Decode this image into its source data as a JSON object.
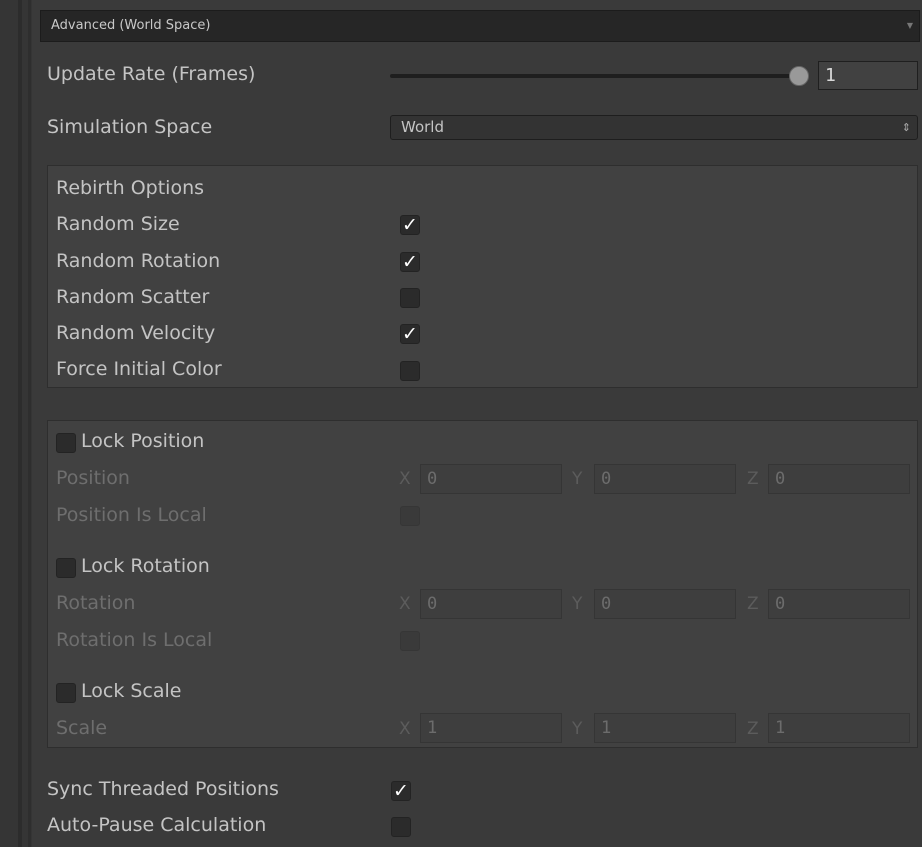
{
  "header": {
    "title": "Advanced (World Space)"
  },
  "update_rate": {
    "label": "Update Rate (Frames)",
    "value": "1",
    "slider_fraction": 1.0
  },
  "simulation_space": {
    "label": "Simulation Space",
    "selected": "World",
    "arrow": "⇕"
  },
  "rebirth": {
    "title": "Rebirth Options",
    "items": [
      {
        "label": "Random Size",
        "checked": true,
        "check": "✓"
      },
      {
        "label": "Random Rotation",
        "checked": true,
        "check": "✓"
      },
      {
        "label": "Random Scatter",
        "checked": false,
        "check": ""
      },
      {
        "label": "Random Velocity",
        "checked": true,
        "check": "✓"
      },
      {
        "label": "Force Initial Color",
        "checked": false,
        "check": ""
      }
    ]
  },
  "locks": {
    "position": {
      "toggle_label": "Lock Position",
      "checked": false,
      "field_label": "Position",
      "x": "0",
      "y": "0",
      "z": "0",
      "local_label": "Position Is Local",
      "local_checked": false
    },
    "rotation": {
      "toggle_label": "Lock Rotation",
      "checked": false,
      "field_label": "Rotation",
      "x": "0",
      "y": "0",
      "z": "0",
      "local_label": "Rotation Is Local",
      "local_checked": false
    },
    "scale": {
      "toggle_label": "Lock Scale",
      "checked": false,
      "field_label": "Scale",
      "x": "1",
      "y": "1",
      "z": "1"
    },
    "axis_letters": {
      "x": "X",
      "y": "Y",
      "z": "Z"
    }
  },
  "sync_threaded": {
    "label": "Sync Threaded Positions",
    "checked": true,
    "check": "✓"
  },
  "auto_pause": {
    "label": "Auto-Pause Calculation",
    "checked": false,
    "check": ""
  },
  "colors": {
    "background": "#3a3a3a",
    "group": "#414141",
    "text": "#c4c4c4",
    "text_disabled": "#6e6e6e"
  }
}
